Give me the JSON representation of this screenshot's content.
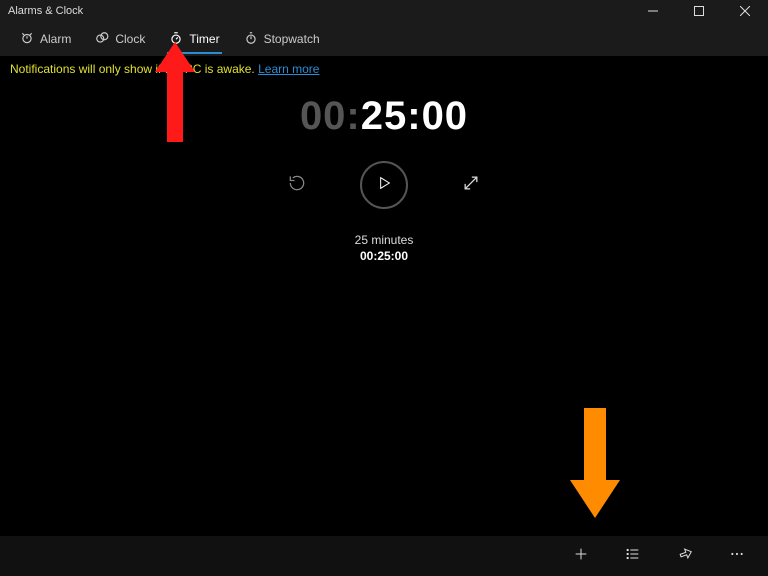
{
  "window": {
    "title": "Alarms & Clock"
  },
  "tabs": [
    {
      "icon": "alarm-icon",
      "label": "Alarm"
    },
    {
      "icon": "clock-icon",
      "label": "Clock"
    },
    {
      "icon": "timer-icon",
      "label": "Timer",
      "active": true
    },
    {
      "icon": "stopwatch-icon",
      "label": "Stopwatch"
    }
  ],
  "notice": {
    "text": "Notifications will only show if the PC is awake. ",
    "link_text": "Learn more"
  },
  "timer": {
    "digits_dim": "00:",
    "digits_bold": "25:00",
    "name": "25 minutes",
    "full": "00:25:00"
  },
  "bottom_icons": [
    "plus-icon",
    "list-icon",
    "pin-icon",
    "more-icon"
  ],
  "annotations": {
    "arrow1_color": "#ff1a1a",
    "arrow2_color": "#ff8c00"
  }
}
